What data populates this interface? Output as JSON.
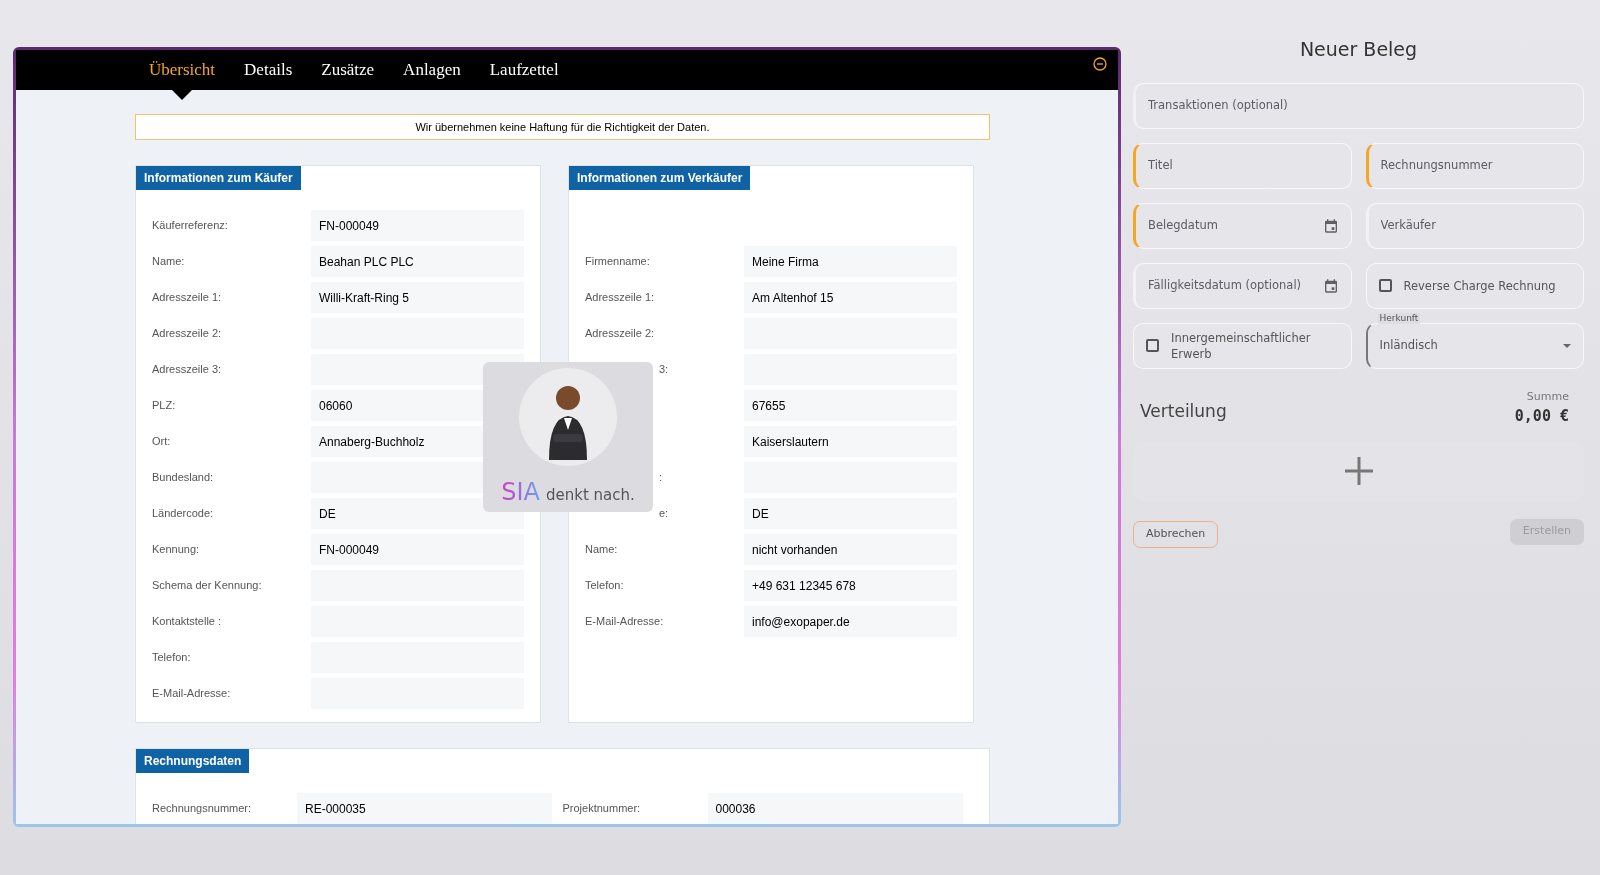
{
  "tabs": [
    {
      "label": "Übersicht",
      "selected": true
    },
    {
      "label": "Details",
      "selected": false
    },
    {
      "label": "Zusätze",
      "selected": false
    },
    {
      "label": "Anlagen",
      "selected": false
    },
    {
      "label": "Laufzettel",
      "selected": false
    }
  ],
  "disclaimer": "Wir übernehmen keine Haftung für die Richtigkeit der Daten.",
  "buyer": {
    "title": "Informationen zum Käufer",
    "rows": [
      {
        "label": "Käuferreferenz:",
        "value": "FN-000049"
      },
      {
        "label": "Name:",
        "value": "Beahan PLC PLC"
      },
      {
        "label": "Adresszeile 1:",
        "value": "Willi-Kraft-Ring 5"
      },
      {
        "label": "Adresszeile 2:"
      },
      {
        "label": "Adresszeile 3:"
      },
      {
        "label": "PLZ:",
        "value": "06060"
      },
      {
        "label": "Ort:",
        "value": "Annaberg-Buchholz"
      },
      {
        "label": "Bundesland:"
      },
      {
        "label": "Ländercode:",
        "value": "DE"
      },
      {
        "label": "Kennung:",
        "value": "FN-000049"
      },
      {
        "label": "Schema der Kennung:"
      },
      {
        "label": "Kontaktstelle :"
      },
      {
        "label": "Telefon:"
      },
      {
        "label": "E-Mail-Adresse:"
      }
    ]
  },
  "seller": {
    "title": "Informationen zum Verkäufer",
    "rows": [
      {
        "label": "Firmenname:",
        "value": "Meine Firma"
      },
      {
        "label": "Adresszeile 1:",
        "value": "Am Altenhof 15"
      },
      {
        "label": "Adresszeile 2:"
      },
      {
        "label": "3:",
        "clipped": true
      },
      {
        "value": "67655"
      },
      {
        "value": "Kaiserslautern"
      },
      {
        "label": ":",
        "clipped": true
      },
      {
        "label": "e:",
        "value": "DE",
        "clipped": true
      },
      {
        "label": "Name:",
        "value": "nicht vorhanden"
      },
      {
        "label": "Telefon:",
        "value": "+49 631 12345 678"
      },
      {
        "label": "E-Mail-Adresse:",
        "value": "info@exopaper.de"
      }
    ]
  },
  "invoice": {
    "title": "Rechnungsdaten",
    "fields": [
      {
        "label": "Rechnungsnummer:",
        "value": "RE-000035"
      },
      {
        "label": "Projektnummer:",
        "value": "000036"
      }
    ]
  },
  "assistant": {
    "brand": "SIA",
    "status": "denkt nach."
  },
  "panel": {
    "title": "Neuer Beleg",
    "fields": [
      {
        "kind": "text",
        "placeholder": "Transaktionen (optional)",
        "required": false,
        "wide": true
      },
      {
        "kind": "text",
        "placeholder": "Titel",
        "required": true,
        "wide": false
      },
      {
        "kind": "text",
        "placeholder": "Rechnungsnummer",
        "required": true,
        "wide": false
      },
      {
        "kind": "date",
        "placeholder": "Belegdatum",
        "required": true,
        "wide": false
      },
      {
        "kind": "text",
        "placeholder": "Verkäufer",
        "required": false,
        "wide": false
      },
      {
        "kind": "date",
        "placeholder": "Fälligkeitsdatum (optional)",
        "required": false,
        "wide": false
      },
      {
        "kind": "checkbox",
        "label": "Reverse Charge Rechnung",
        "checked": false,
        "wide": false
      },
      {
        "kind": "checkbox",
        "label": "Innergemeinschaftlicher Erwerb",
        "checked": false,
        "wide": false
      },
      {
        "kind": "select",
        "label": "Herkunft",
        "value": "Inländisch",
        "wide": false
      }
    ],
    "section": "Verteilung",
    "sum_label": "Summe",
    "sum": "0,00 €",
    "cancel": "Abbrechen",
    "create": {
      "label": "Erstellen",
      "disabled": true
    }
  }
}
